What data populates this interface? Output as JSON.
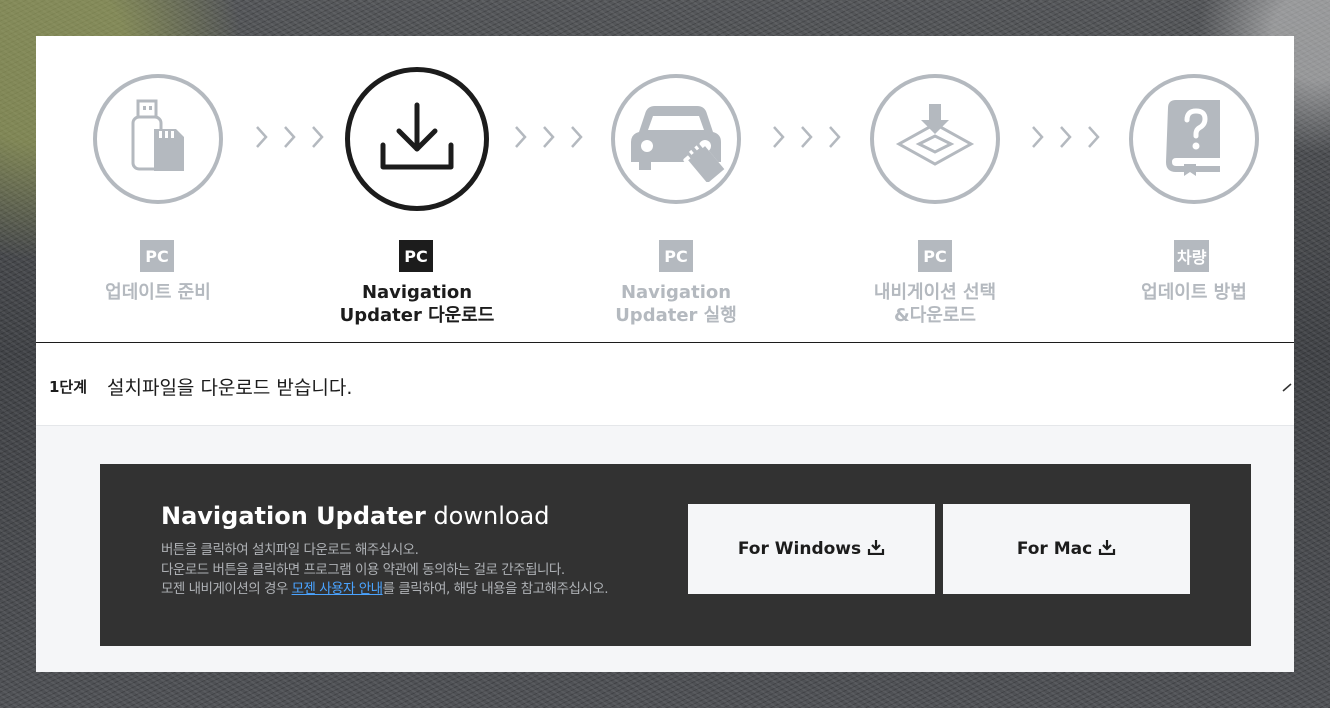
{
  "steps": [
    {
      "badge": "PC",
      "label_line1": "업데이트 준비",
      "label_line2": "",
      "icon": "usb-sd-card-icon",
      "active": false
    },
    {
      "badge": "PC",
      "label_line1": "Navigation",
      "label_line2": "Updater 다운로드",
      "icon": "download-icon",
      "active": true
    },
    {
      "badge": "PC",
      "label_line1": "Navigation",
      "label_line2": "Updater 실행",
      "icon": "car-usb-icon",
      "active": false
    },
    {
      "badge": "PC",
      "label_line1": "내비게이션 선택",
      "label_line2": "&다운로드",
      "icon": "download-select-icon",
      "active": false
    },
    {
      "badge": "차량",
      "label_line1": "업데이트 방법",
      "label_line2": "",
      "icon": "manual-book-icon",
      "active": false
    }
  ],
  "section": {
    "step_label": "1단계",
    "title": "설치파일을 다운로드 받습니다."
  },
  "download": {
    "title_bold": "Navigation Updater",
    "title_light": "download",
    "desc_line1": "버튼을 클릭하여 설치파일 다운로드 해주십시오.",
    "desc_line2": "다운로드 버튼을 클릭하면 프로그램 이용 약관에 동의하는 걸로 간주됩니다.",
    "desc_line3_prefix": "모젠 내비게이션의 경우 ",
    "desc_link": "모젠 사용자 안내",
    "desc_line3_suffix": "를 클릭하여, 해당 내용을 참고해주십시오.",
    "windows_label": "For Windows",
    "mac_label": "For Mac"
  },
  "colors": {
    "active": "#1c1c1c",
    "inactive": "#b4b9bf",
    "dark_box": "#323232",
    "link": "#4aa3ff"
  }
}
